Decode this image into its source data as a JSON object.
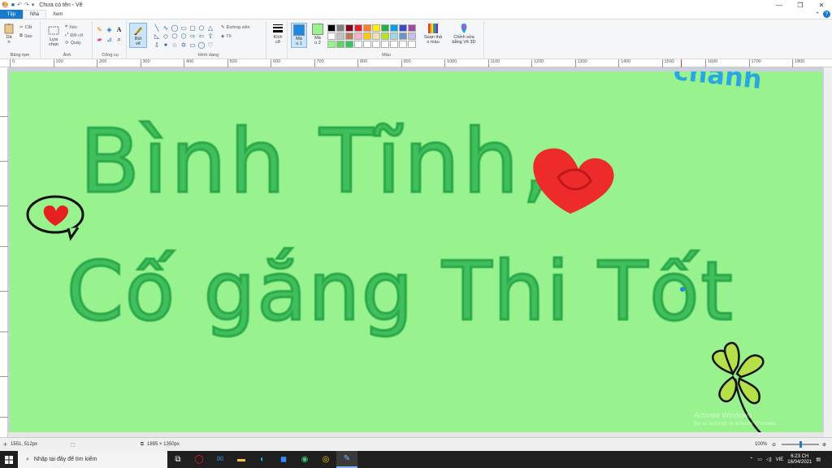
{
  "window": {
    "title": "Chưa có tên - Vẽ",
    "controls": [
      "minimize-icon",
      "maximize-icon",
      "close-icon"
    ]
  },
  "tabs": [
    {
      "label": "Tệp"
    },
    {
      "label": "Nhà"
    },
    {
      "label": "Xem"
    }
  ],
  "ribbon": {
    "clipboard": {
      "paste_label": "Dá\nn",
      "cut_label": "Cắt",
      "copy_label": "Sao",
      "group_label": "Bảng tạm"
    },
    "image": {
      "select_label": "Lựa\nchọn",
      "crop_label": "Xén",
      "resize_label": "Đổi cỡ",
      "rotate_label": "Quay",
      "group_label": "Ảnh"
    },
    "tools": {
      "group_label": "Công cụ"
    },
    "brushes": {
      "label": "Bút\nvẽ"
    },
    "shapes": {
      "outline_label": "Đường viền",
      "fill_label": "Tô",
      "group_label": "Hình dạng"
    },
    "size": {
      "label": "Kích\ncỡ"
    },
    "colors": {
      "color1_label": "Mà\nu 1",
      "color2_label": "Mà\nu 2",
      "edit_colors_label": "Soạn thả\no màu",
      "paint3d_label": "Chỉnh sửa\nbằng Vẽ 3D",
      "group_label": "Màu",
      "color1_value": "#1e88e5",
      "color2_value": "#98f38f",
      "palette": [
        "#000000",
        "#7f7f7f",
        "#880015",
        "#ed1c24",
        "#ff7f27",
        "#fff200",
        "#22b14c",
        "#00a2e8",
        "#3f48cc",
        "#a349a4",
        "#ffffff",
        "#c3c3c3",
        "#b97a57",
        "#ffaec9",
        "#ffc90e",
        "#efe4b0",
        "#b5e61d",
        "#99d9ea",
        "#7092be",
        "#c8bfe7",
        "#98f38f",
        "#5fd85a",
        "#34c759",
        "#ffffff",
        "#ffffff",
        "#ffffff",
        "#ffffff",
        "#ffffff",
        "#ffffff",
        "#ffffff"
      ]
    }
  },
  "ruler": {
    "h_labels": [
      "0",
      "100",
      "200",
      "300",
      "400",
      "500",
      "600",
      "700",
      "800",
      "900",
      "1000",
      "1100",
      "1200",
      "1300",
      "1400",
      "1500",
      "1600",
      "1700",
      "1800"
    ]
  },
  "canvas": {
    "background": "#98f38f",
    "texts": {
      "line1": "Bình Tĩnh,",
      "line2": "Cố gắng Thi Tốt",
      "signature": "chanh"
    }
  },
  "watermark": {
    "line1": "Activate Windows",
    "line2": "Go to Settings to activate Windows."
  },
  "status": {
    "cursor_pos": "1551, 512px",
    "image_size": "1895 × 1350px",
    "zoom": "100%",
    "zoom_percent": 100
  },
  "taskbar": {
    "search_placeholder": "Nhập tại đây để tìm kiếm",
    "language": "VIE",
    "time": "6:23 CH",
    "date": "16/04/2021",
    "apps": [
      "task-view-icon",
      "opera-icon",
      "mail-icon",
      "folder-icon",
      "edge-icon",
      "zoom-icon",
      "zalo-icon",
      "chrome-icon",
      "paint-icon"
    ]
  }
}
